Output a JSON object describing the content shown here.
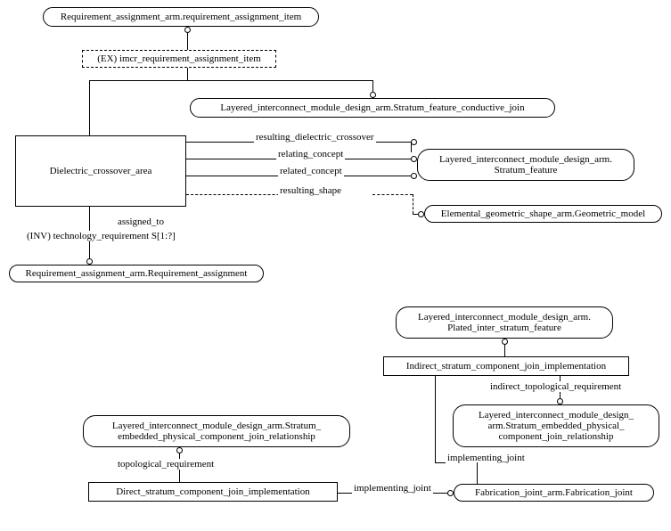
{
  "boxes": {
    "req_assignment_item": "Requirement_assignment_arm.requirement_assignment_item",
    "ex_imcr": "(EX) imcr_requirement_assignment_item",
    "stratum_feature_conductive_join": "Layered_interconnect_module_design_arm.Stratum_feature_conductive_join",
    "dielectric_crossover_area": "Dielectric_crossover_area",
    "stratum_feature_line1": "Layered_interconnect_module_design_arm.",
    "stratum_feature_line2": "Stratum_feature",
    "elemental_geometric": "Elemental_geometric_shape_arm.Geometric_model",
    "req_assignment": "Requirement_assignment_arm.Requirement_assignment",
    "plated_inter_line1": "Layered_interconnect_module_design_arm.",
    "plated_inter_line2": "Plated_inter_stratum_feature",
    "indirect_stratum": "Indirect_stratum_component_join_implementation",
    "layered_stratum_embedded_line1": "Layered_interconnect_module_design_",
    "layered_stratum_embedded_line2": "arm.Stratum_embedded_physical_",
    "layered_stratum_embedded_line3": "component_join_relationship",
    "layered_embedded_left_line1": "Layered_interconnect_module_design_arm.Stratum_",
    "layered_embedded_left_line2": "embedded_physical_component_join_relationship",
    "direct_stratum": "Direct_stratum_component_join_implementation",
    "fabrication_joint": "Fabrication_joint_arm.Fabrication_joint"
  },
  "labels": {
    "resulting_dielectric": "resulting_dielectric_crossover",
    "relating_concept": "relating_concept",
    "related_concept": "related_concept",
    "resulting_shape": "resulting_shape",
    "assigned_to": "assigned_to",
    "inv_tech": "(INV) technology_requirement S[1:?]",
    "indirect_topological": "indirect_topological_requirement",
    "implementing_joint1": "implementing_joint",
    "topological_req": "topological_requirement",
    "implementing_joint2": "implementing_joint"
  }
}
